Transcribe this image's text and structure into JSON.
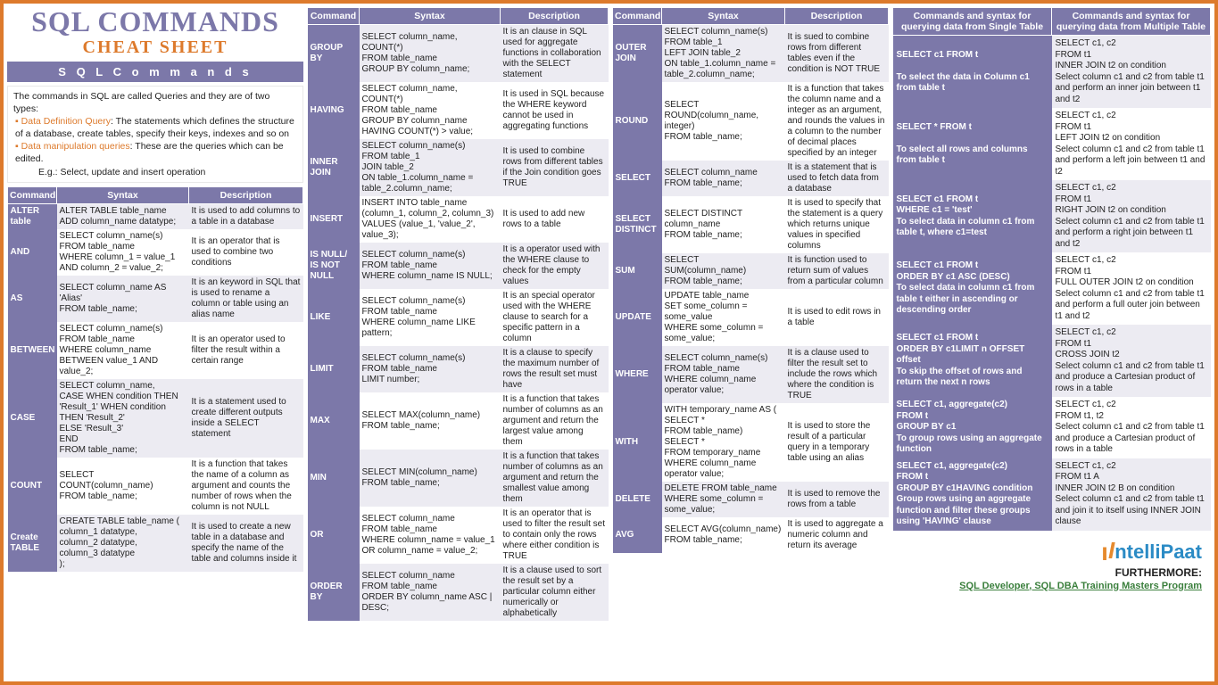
{
  "title": {
    "main": "SQL COMMANDS",
    "sub": "CHEAT SHEET"
  },
  "banner": "S Q L   C o m m a n d s",
  "intro": {
    "lead": "The commands in SQL are called Queries and they are of two types:",
    "b1_head": "Data Definition Query",
    "b1_body": ": The statements which defines the structure of a database, create tables, specify their keys, indexes and so on",
    "b2_head": "Data manipulation queries",
    "b2_body": ": These are the queries which can be edited.",
    "eg": "E.g.: Select, update and insert operation"
  },
  "headers": {
    "cmd": "Command",
    "syn": "Syntax",
    "desc": "Description"
  },
  "t1": [
    {
      "c": "ALTER table",
      "s": "ALTER TABLE table_name\nADD column_name datatype;",
      "d": "It is used to add columns to a table in a database"
    },
    {
      "c": "AND",
      "s": "SELECT column_name(s)\nFROM table_name\nWHERE column_1 = value_1\nAND column_2 = value_2;",
      "d": "It is an operator that is used to combine two conditions"
    },
    {
      "c": "AS",
      "s": "SELECT column_name AS 'Alias'\nFROM table_name;",
      "d": "It is an keyword in SQL that is used to rename a column or table using an alias name"
    },
    {
      "c": "BETWEEN",
      "s": "SELECT column_name(s)\nFROM table_name\nWHERE column_name\nBETWEEN value_1 AND value_2;",
      "d": "It is an operator used to filter the result within a certain range"
    },
    {
      "c": "CASE",
      "s": "SELECT column_name,\nCASE   WHEN condition THEN 'Result_1'   WHEN condition THEN 'Result_2'\nELSE 'Result_3'\nEND\nFROM table_name;",
      "d": "It is a statement used to create different outputs inside a SELECT statement"
    },
    {
      "c": "COUNT",
      "s": "SELECT COUNT(column_name)\nFROM table_name;",
      "d": "It is a function that takes the name of a column as argument and counts the number of rows when the column is not NULL"
    },
    {
      "c": "Create TABLE",
      "s": "CREATE TABLE table_name (\ncolumn_1 datatype,\ncolumn_2 datatype,\ncolumn_3 datatype\n);",
      "d": "It is used to create a new table in a database and specify the name of the table and columns inside it"
    }
  ],
  "t2": [
    {
      "c": "GROUP BY",
      "s": "SELECT column_name, COUNT(*)\nFROM table_name\nGROUP BY column_name;",
      "d": "It is an clause in SQL used for aggregate functions in collaboration with the SELECT statement"
    },
    {
      "c": "HAVING",
      "s": "SELECT column_name, COUNT(*)\nFROM table_name\nGROUP BY column_name\nHAVING COUNT(*) > value;",
      "d": "It is used in SQL because the WHERE keyword cannot be used in aggregating functions"
    },
    {
      "c": "INNER JOIN",
      "s": "SELECT column_name(s)\nFROM table_1\nJOIN table_2\nON table_1.column_name = table_2.column_name;",
      "d": "It is used to combine rows from different tables if the Join condition goes TRUE"
    },
    {
      "c": "INSERT",
      "s": "INSERT INTO table_name (column_1, column_2, column_3) VALUES (value_1, 'value_2', value_3);",
      "d": "It is used to add new rows to a table"
    },
    {
      "c": "IS NULL/ IS NOT NULL",
      "s": "SELECT column_name(s)\nFROM table_name\nWHERE column_name IS NULL;",
      "d": "It is a operator used with the WHERE clause to check for the empty values"
    },
    {
      "c": "LIKE",
      "s": "SELECT column_name(s)\nFROM table_name\nWHERE column_name LIKE pattern;",
      "d": "It is an special operator used with the WHERE clause to search for a specific pattern in a column"
    },
    {
      "c": "LIMIT",
      "s": "SELECT column_name(s)\nFROM table_name\nLIMIT number;",
      "d": "It is a clause to specify the maximum number of rows the result set must have"
    },
    {
      "c": "MAX",
      "s": "SELECT MAX(column_name)\nFROM table_name;",
      "d": "It is a function that takes number of columns as an argument and return the largest value among them"
    },
    {
      "c": "MIN",
      "s": "SELECT MIN(column_name)\nFROM table_name;",
      "d": "It is a function that takes number of columns as an argument and return the smallest value among them"
    },
    {
      "c": "OR",
      "s": "SELECT column_name\nFROM table_name\nWHERE column_name = value_1\nOR column_name = value_2;",
      "d": "It is an operator that is used to filter the result set to contain only the rows where either condition is TRUE"
    },
    {
      "c": "ORDER BY",
      "s": "SELECT column_name\nFROM table_name\nORDER BY column_name ASC | DESC;",
      "d": "It is a clause used to sort the result set by a particular column either numerically or alphabetically"
    }
  ],
  "t3": [
    {
      "c": "OUTER JOIN",
      "s": "SELECT column_name(s)\nFROM table_1\nLEFT JOIN table_2\nON table_1.column_name = table_2.column_name;",
      "d": "It is sued to combine rows from different tables even if the condition is NOT TRUE"
    },
    {
      "c": "ROUND",
      "s": "SELECT ROUND(column_name, integer)\nFROM table_name;",
      "d": "It is a function that takes the column name and a integer as an argument, and rounds the values in a column to the number of decimal places specified by an integer"
    },
    {
      "c": "SELECT",
      "s": "SELECT column_name\nFROM table_name;",
      "d": "It is a statement that is used to fetch data from a database"
    },
    {
      "c": "SELECT DISTINCT",
      "s": "SELECT DISTINCT column_name\nFROM table_name;",
      "d": "It is used to specify that the statement is a query which returns unique values in specified columns"
    },
    {
      "c": "SUM",
      "s": "SELECT SUM(column_name)\nFROM table_name;",
      "d": "It is function used to return sum of values from a particular column"
    },
    {
      "c": "UPDATE",
      "s": "UPDATE table_name\nSET some_column = some_value\nWHERE some_column = some_value;",
      "d": "It is used to edit rows in a table"
    },
    {
      "c": "WHERE",
      "s": "SELECT column_name(s)\nFROM table_name\nWHERE column_name operator value;",
      "d": "It is a clause used to filter the result set to include the rows which where the condition is TRUE"
    },
    {
      "c": "WITH",
      "s": "WITH temporary_name AS (\nSELECT *\nFROM table_name)\nSELECT *\nFROM temporary_name\nWHERE column_name operator value;",
      "d": "It is used to store the result of a particular query in a temporary table using an alias"
    },
    {
      "c": "DELETE",
      "s": "DELETE FROM table_name\nWHERE some_column = some_value;",
      "d": "It is used to remove the rows from a table"
    },
    {
      "c": "AVG",
      "s": "SELECT AVG(column_name)\nFROM table_name;",
      "d": "It is used to aggregate a numeric column and return its average"
    }
  ],
  "t4_headers": {
    "left": "Commands and syntax for querying data from Single Table",
    "right": "Commands and syntax for querying data from Multiple Table"
  },
  "t4": [
    {
      "l": "SELECT c1 FROM t\n\nTo select the data in Column c1 from table t",
      "r": "SELECT c1, c2\nFROM t1\nINNER JOIN t2 on condition\nSelect column c1 and c2 from table t1 and perform an inner join between t1 and t2"
    },
    {
      "l": "SELECT * FROM t\n\nTo select all rows and columns from table t",
      "r": "SELECT c1, c2\nFROM t1\nLEFT JOIN t2 on condition\nSelect column c1 and c2 from table t1 and perform a left join between t1 and t2"
    },
    {
      "l": "SELECT c1 FROM t\nWHERE c1 = 'test'\nTo select data in column c1 from table t, where c1=test",
      "r": "SELECT c1, c2\nFROM t1\nRIGHT JOIN t2 on condition\nSelect column c1 and c2 from table t1 and perform a right join between t1 and t2"
    },
    {
      "l": "SELECT c1 FROM t\nORDER BY c1 ASC (DESC)\nTo select data in column c1 from table t either in ascending or descending order",
      "r": "SELECT c1, c2\nFROM t1\nFULL OUTER JOIN t2 on condition\nSelect column c1 and c2 from table t1 and perform a full outer join between t1 and t2"
    },
    {
      "l": "SELECT c1 FROM t\nORDER BY c1LIMIT n OFFSET offset\nTo skip the offset of rows and return the next n rows",
      "r": "SELECT c1, c2\nFROM t1\nCROSS JOIN t2\nSelect column c1 and c2 from table t1 and produce a Cartesian product of rows in a table"
    },
    {
      "l": "SELECT c1, aggregate(c2)\nFROM t\nGROUP BY c1\nTo group rows using an aggregate function",
      "r": "SELECT c1, c2\nFROM t1, t2\nSelect column c1 and c2 from table t1 and produce a Cartesian product of rows in a table"
    },
    {
      "l": "SELECT c1, aggregate(c2)\nFROM t\nGROUP BY c1HAVING condition\nGroup rows using an aggregate function and filter these groups using 'HAVING' clause",
      "r": "SELECT c1, c2\nFROM t1 A\nINNER JOIN t2 B on condition\nSelect column c1 and c2 from table t1 and join it to itself using INNER JOIN clause"
    }
  ],
  "footer": {
    "brand": "ntelliPaat",
    "more": "FURTHERMORE:",
    "link": "SQL Developer, SQL DBA Training Masters Program"
  }
}
